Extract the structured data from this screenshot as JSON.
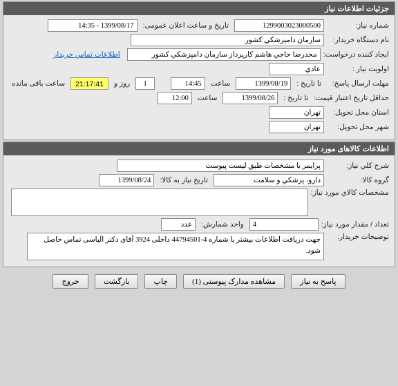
{
  "panel1": {
    "title": "جزئیات اطلاعات نیاز",
    "reqno_label": "شماره نیاز:",
    "reqno": "1299003023000500",
    "pubdate_label": "تاریخ و ساعت اعلان عمومی:",
    "pubdate": "1399/08/17 - 14:35",
    "buyer_label": "نام دستگاه خریدار:",
    "buyer": "سازمان دامپزشکي کشور",
    "creator_label": "ایجاد کننده درخواست:",
    "creator": "محدرضا حاجي هاشم کارپرداز سازمان دامپزشکي کشور",
    "contact_link": "اطلاعات تماس خریدار",
    "priority_label": "اولویت نیاز :",
    "priority": "عادي",
    "deadline_send_label": "مهلت ارسال پاسخ:",
    "to_date_label": "تا تاریخ :",
    "deadline_date": "1399/08/19",
    "time_label": "ساعت",
    "deadline_time": "14:45",
    "days": "1",
    "days_label": "روز و",
    "remaining_time": "21:17:41",
    "remaining_label": "ساعت باقی مانده",
    "validity_label": "حداقل تاریخ اعتبار قیمت:",
    "validity_date": "1399/08/26",
    "validity_time": "12:00",
    "province_label": "استان محل تحویل:",
    "province": "تهران",
    "city_label": "شهر محل تحویل:",
    "city": "تهران"
  },
  "panel2": {
    "title": "اطلاعات کالاهای مورد نیاز",
    "desc_label": "شرح کلي نیاز:",
    "desc": "پرایمر با مشخصات طبق لیست پیوست",
    "group_label": "گروه کالا:",
    "group": "دارو، پزشکي و سلامت",
    "need_date_label": "تاریخ نیاز به کالا:",
    "need_date": "1399/08/24",
    "spec_label": "مشخصات کالاي مورد نیاز:",
    "spec": "",
    "qty_label": "تعداد / مقدار مورد نیاز:",
    "qty": "4",
    "unit_label": "واحد شمارش:",
    "unit": "عدد",
    "notes_label": "توضیحات خریدار:",
    "notes": "جهت دریافت اطلاعات بیشتر با شماره 4-44794501 داخلی 3924 آقای دکتر الیاسی تماس حاصل شود."
  },
  "buttons": {
    "respond": "پاسخ به نیاز",
    "attachments": "مشاهده مدارک پیوستی (1)",
    "print": "چاپ",
    "back": "بازگشت",
    "exit": "خروج"
  }
}
